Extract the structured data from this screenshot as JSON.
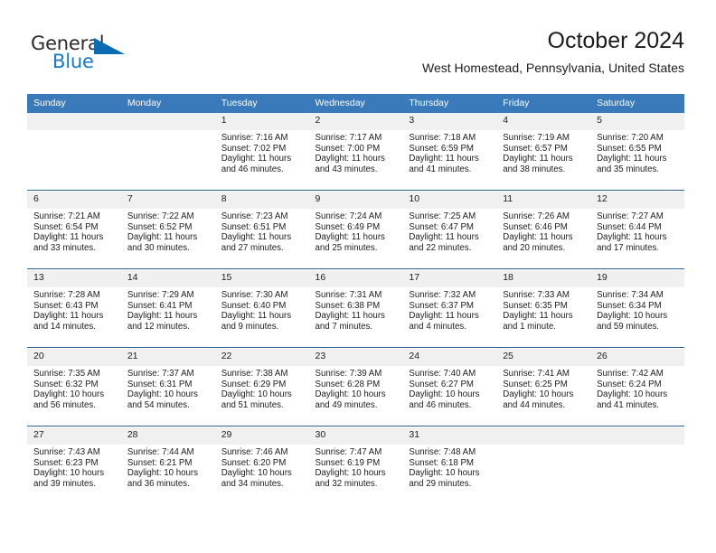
{
  "logo": {
    "word_one": "General",
    "word_two": "Blue",
    "triangle_icon": "triangle-icon"
  },
  "header": {
    "title": "October 2024",
    "subtitle": "West Homestead, Pennsylvania, United States"
  },
  "colors": {
    "header_blue": "#3a79ba",
    "separator_blue": "#2d5f8f",
    "daynum_band": "#f0f0f0",
    "logo_blue": "#1878c8",
    "text": "#1c1c1c"
  },
  "weekday_headers": [
    "Sunday",
    "Monday",
    "Tuesday",
    "Wednesday",
    "Thursday",
    "Friday",
    "Saturday"
  ],
  "weeks": [
    {
      "days": [
        {
          "num": "",
          "empty": true,
          "sunrise": "",
          "sunset": "",
          "daylight_1": "",
          "daylight_2": ""
        },
        {
          "num": "",
          "empty": true,
          "sunrise": "",
          "sunset": "",
          "daylight_1": "",
          "daylight_2": ""
        },
        {
          "num": "1",
          "empty": false,
          "sunrise": "Sunrise: 7:16 AM",
          "sunset": "Sunset: 7:02 PM",
          "daylight_1": "Daylight: 11 hours",
          "daylight_2": "and 46 minutes."
        },
        {
          "num": "2",
          "empty": false,
          "sunrise": "Sunrise: 7:17 AM",
          "sunset": "Sunset: 7:00 PM",
          "daylight_1": "Daylight: 11 hours",
          "daylight_2": "and 43 minutes."
        },
        {
          "num": "3",
          "empty": false,
          "sunrise": "Sunrise: 7:18 AM",
          "sunset": "Sunset: 6:59 PM",
          "daylight_1": "Daylight: 11 hours",
          "daylight_2": "and 41 minutes."
        },
        {
          "num": "4",
          "empty": false,
          "sunrise": "Sunrise: 7:19 AM",
          "sunset": "Sunset: 6:57 PM",
          "daylight_1": "Daylight: 11 hours",
          "daylight_2": "and 38 minutes."
        },
        {
          "num": "5",
          "empty": false,
          "sunrise": "Sunrise: 7:20 AM",
          "sunset": "Sunset: 6:55 PM",
          "daylight_1": "Daylight: 11 hours",
          "daylight_2": "and 35 minutes."
        }
      ]
    },
    {
      "days": [
        {
          "num": "6",
          "empty": false,
          "sunrise": "Sunrise: 7:21 AM",
          "sunset": "Sunset: 6:54 PM",
          "daylight_1": "Daylight: 11 hours",
          "daylight_2": "and 33 minutes."
        },
        {
          "num": "7",
          "empty": false,
          "sunrise": "Sunrise: 7:22 AM",
          "sunset": "Sunset: 6:52 PM",
          "daylight_1": "Daylight: 11 hours",
          "daylight_2": "and 30 minutes."
        },
        {
          "num": "8",
          "empty": false,
          "sunrise": "Sunrise: 7:23 AM",
          "sunset": "Sunset: 6:51 PM",
          "daylight_1": "Daylight: 11 hours",
          "daylight_2": "and 27 minutes."
        },
        {
          "num": "9",
          "empty": false,
          "sunrise": "Sunrise: 7:24 AM",
          "sunset": "Sunset: 6:49 PM",
          "daylight_1": "Daylight: 11 hours",
          "daylight_2": "and 25 minutes."
        },
        {
          "num": "10",
          "empty": false,
          "sunrise": "Sunrise: 7:25 AM",
          "sunset": "Sunset: 6:47 PM",
          "daylight_1": "Daylight: 11 hours",
          "daylight_2": "and 22 minutes."
        },
        {
          "num": "11",
          "empty": false,
          "sunrise": "Sunrise: 7:26 AM",
          "sunset": "Sunset: 6:46 PM",
          "daylight_1": "Daylight: 11 hours",
          "daylight_2": "and 20 minutes."
        },
        {
          "num": "12",
          "empty": false,
          "sunrise": "Sunrise: 7:27 AM",
          "sunset": "Sunset: 6:44 PM",
          "daylight_1": "Daylight: 11 hours",
          "daylight_2": "and 17 minutes."
        }
      ]
    },
    {
      "days": [
        {
          "num": "13",
          "empty": false,
          "sunrise": "Sunrise: 7:28 AM",
          "sunset": "Sunset: 6:43 PM",
          "daylight_1": "Daylight: 11 hours",
          "daylight_2": "and 14 minutes."
        },
        {
          "num": "14",
          "empty": false,
          "sunrise": "Sunrise: 7:29 AM",
          "sunset": "Sunset: 6:41 PM",
          "daylight_1": "Daylight: 11 hours",
          "daylight_2": "and 12 minutes."
        },
        {
          "num": "15",
          "empty": false,
          "sunrise": "Sunrise: 7:30 AM",
          "sunset": "Sunset: 6:40 PM",
          "daylight_1": "Daylight: 11 hours",
          "daylight_2": "and 9 minutes."
        },
        {
          "num": "16",
          "empty": false,
          "sunrise": "Sunrise: 7:31 AM",
          "sunset": "Sunset: 6:38 PM",
          "daylight_1": "Daylight: 11 hours",
          "daylight_2": "and 7 minutes."
        },
        {
          "num": "17",
          "empty": false,
          "sunrise": "Sunrise: 7:32 AM",
          "sunset": "Sunset: 6:37 PM",
          "daylight_1": "Daylight: 11 hours",
          "daylight_2": "and 4 minutes."
        },
        {
          "num": "18",
          "empty": false,
          "sunrise": "Sunrise: 7:33 AM",
          "sunset": "Sunset: 6:35 PM",
          "daylight_1": "Daylight: 11 hours",
          "daylight_2": "and 1 minute."
        },
        {
          "num": "19",
          "empty": false,
          "sunrise": "Sunrise: 7:34 AM",
          "sunset": "Sunset: 6:34 PM",
          "daylight_1": "Daylight: 10 hours",
          "daylight_2": "and 59 minutes."
        }
      ]
    },
    {
      "days": [
        {
          "num": "20",
          "empty": false,
          "sunrise": "Sunrise: 7:35 AM",
          "sunset": "Sunset: 6:32 PM",
          "daylight_1": "Daylight: 10 hours",
          "daylight_2": "and 56 minutes."
        },
        {
          "num": "21",
          "empty": false,
          "sunrise": "Sunrise: 7:37 AM",
          "sunset": "Sunset: 6:31 PM",
          "daylight_1": "Daylight: 10 hours",
          "daylight_2": "and 54 minutes."
        },
        {
          "num": "22",
          "empty": false,
          "sunrise": "Sunrise: 7:38 AM",
          "sunset": "Sunset: 6:29 PM",
          "daylight_1": "Daylight: 10 hours",
          "daylight_2": "and 51 minutes."
        },
        {
          "num": "23",
          "empty": false,
          "sunrise": "Sunrise: 7:39 AM",
          "sunset": "Sunset: 6:28 PM",
          "daylight_1": "Daylight: 10 hours",
          "daylight_2": "and 49 minutes."
        },
        {
          "num": "24",
          "empty": false,
          "sunrise": "Sunrise: 7:40 AM",
          "sunset": "Sunset: 6:27 PM",
          "daylight_1": "Daylight: 10 hours",
          "daylight_2": "and 46 minutes."
        },
        {
          "num": "25",
          "empty": false,
          "sunrise": "Sunrise: 7:41 AM",
          "sunset": "Sunset: 6:25 PM",
          "daylight_1": "Daylight: 10 hours",
          "daylight_2": "and 44 minutes."
        },
        {
          "num": "26",
          "empty": false,
          "sunrise": "Sunrise: 7:42 AM",
          "sunset": "Sunset: 6:24 PM",
          "daylight_1": "Daylight: 10 hours",
          "daylight_2": "and 41 minutes."
        }
      ]
    },
    {
      "days": [
        {
          "num": "27",
          "empty": false,
          "sunrise": "Sunrise: 7:43 AM",
          "sunset": "Sunset: 6:23 PM",
          "daylight_1": "Daylight: 10 hours",
          "daylight_2": "and 39 minutes."
        },
        {
          "num": "28",
          "empty": false,
          "sunrise": "Sunrise: 7:44 AM",
          "sunset": "Sunset: 6:21 PM",
          "daylight_1": "Daylight: 10 hours",
          "daylight_2": "and 36 minutes."
        },
        {
          "num": "29",
          "empty": false,
          "sunrise": "Sunrise: 7:46 AM",
          "sunset": "Sunset: 6:20 PM",
          "daylight_1": "Daylight: 10 hours",
          "daylight_2": "and 34 minutes."
        },
        {
          "num": "30",
          "empty": false,
          "sunrise": "Sunrise: 7:47 AM",
          "sunset": "Sunset: 6:19 PM",
          "daylight_1": "Daylight: 10 hours",
          "daylight_2": "and 32 minutes."
        },
        {
          "num": "31",
          "empty": false,
          "sunrise": "Sunrise: 7:48 AM",
          "sunset": "Sunset: 6:18 PM",
          "daylight_1": "Daylight: 10 hours",
          "daylight_2": "and 29 minutes."
        },
        {
          "num": "",
          "empty": true,
          "sunrise": "",
          "sunset": "",
          "daylight_1": "",
          "daylight_2": ""
        },
        {
          "num": "",
          "empty": true,
          "sunrise": "",
          "sunset": "",
          "daylight_1": "",
          "daylight_2": ""
        }
      ]
    }
  ]
}
